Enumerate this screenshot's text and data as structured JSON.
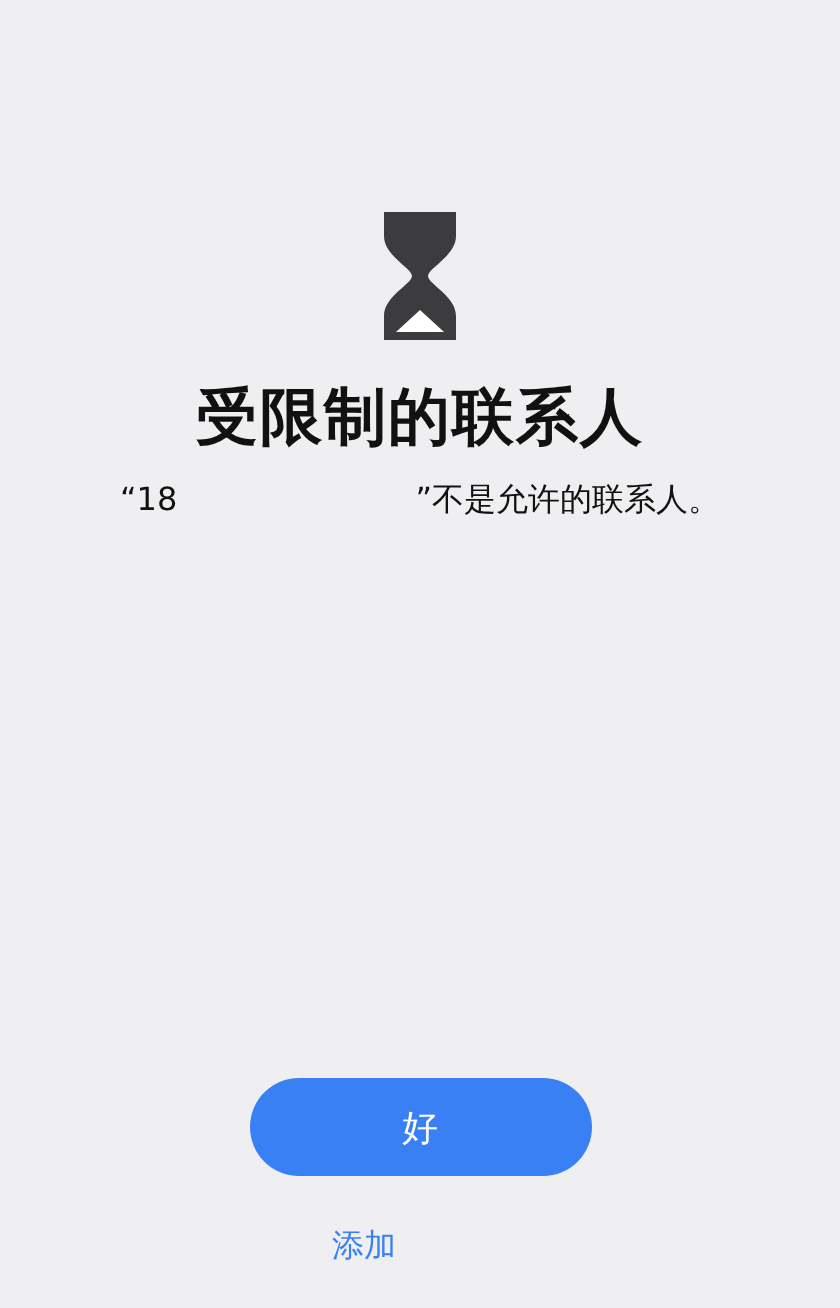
{
  "title": "受限制的联系人",
  "message": {
    "number": "“18",
    "rest": "”不是允许的联系人。"
  },
  "ok_button": "好",
  "link": "添加"
}
